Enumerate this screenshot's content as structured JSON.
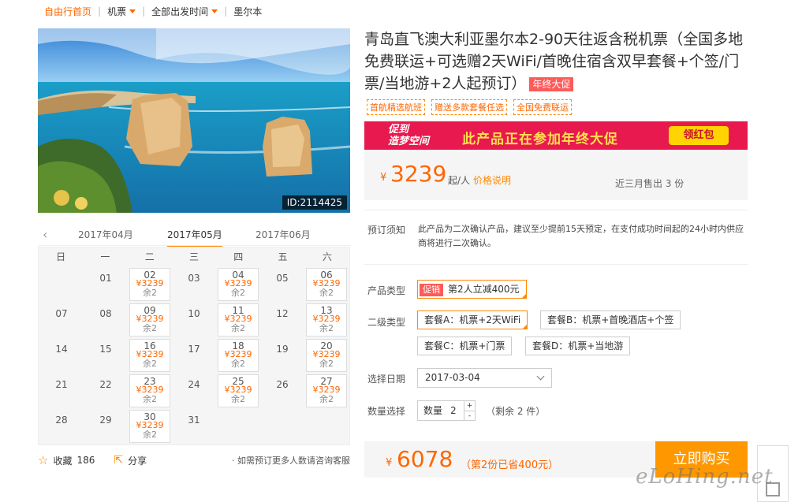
{
  "breadcrumb": {
    "home": "自由行首页",
    "item2": "机票",
    "item3": "全部出发时间",
    "item4": "墨尔本"
  },
  "hero": {
    "id_label": "ID:2114425"
  },
  "calendar": {
    "months": [
      "2017年04月",
      "2017年05月",
      "2017年06月"
    ],
    "current_month_index": 1,
    "weekdays": [
      "日",
      "一",
      "二",
      "三",
      "四",
      "五",
      "六"
    ],
    "leading_blanks": 1,
    "days": [
      {
        "d": "01"
      },
      {
        "d": "02",
        "price": "¥3239",
        "remain": "余2"
      },
      {
        "d": "03"
      },
      {
        "d": "04",
        "price": "¥3239",
        "remain": "余2"
      },
      {
        "d": "05"
      },
      {
        "d": "06",
        "price": "¥3239",
        "remain": "余2"
      },
      {
        "d": "07"
      },
      {
        "d": "08"
      },
      {
        "d": "09",
        "price": "¥3239",
        "remain": "余2"
      },
      {
        "d": "10"
      },
      {
        "d": "11",
        "price": "¥3239",
        "remain": "余2"
      },
      {
        "d": "12"
      },
      {
        "d": "13",
        "price": "¥3239",
        "remain": "余2"
      },
      {
        "d": "14"
      },
      {
        "d": "15"
      },
      {
        "d": "16",
        "price": "¥3239",
        "remain": "余2"
      },
      {
        "d": "17"
      },
      {
        "d": "18",
        "price": "¥3239",
        "remain": "余2"
      },
      {
        "d": "19"
      },
      {
        "d": "20",
        "price": "¥3239",
        "remain": "余2"
      },
      {
        "d": "21"
      },
      {
        "d": "22"
      },
      {
        "d": "23",
        "price": "¥3239",
        "remain": "余2"
      },
      {
        "d": "24"
      },
      {
        "d": "25",
        "price": "¥3239",
        "remain": "余2"
      },
      {
        "d": "26"
      },
      {
        "d": "27",
        "price": "¥3239",
        "remain": "余2"
      },
      {
        "d": "28"
      },
      {
        "d": "29"
      },
      {
        "d": "30",
        "price": "¥3239",
        "remain": "余2"
      },
      {
        "d": "31"
      }
    ]
  },
  "footer": {
    "collect_label": "收藏",
    "collect_count": "186",
    "share_label": "分享",
    "note": "· 如需预订更多人数请咨询客服"
  },
  "product": {
    "title": "青岛直飞澳大利亚墨尔本2-90天往返含税机票（全国多地免费联运+可选赠2天WiFi/首晚住宿含双早套餐+个签/门票/当地游+2人起预订）",
    "promo_badge": "年终大促",
    "tags": [
      "首航精选航班",
      "赠送多款套餐任选",
      "全国免费联运"
    ]
  },
  "banner": {
    "logo_line1": "促到",
    "logo_line2": "造梦空间",
    "text": "此产品正在参加年终大促",
    "button": "领红包"
  },
  "price": {
    "currency": "¥",
    "amount": "3239",
    "unit": "起/人",
    "explain": "价格说明",
    "sold": "近三月售出 3 份"
  },
  "notice": {
    "label": "预订须知",
    "text": "此产品为二次确认产品，建议至少提前15天预定，在支付成功时间起的24小时内供应商将进行二次确认。"
  },
  "options": {
    "type_label": "产品类型",
    "type_tag": "促销",
    "type_value": "第2人立减400元",
    "sub_label": "二级类型",
    "packages": [
      "套餐A：机票+2天WiFi",
      "套餐B：机票+首晚酒店+个签",
      "套餐C：机票+门票",
      "套餐D：机票+当地游"
    ],
    "date_label": "选择日期",
    "date_value": "2017-03-04",
    "qty_label": "数量选择",
    "qty_prefix": "数量",
    "qty_value": "2",
    "qty_plus": "+",
    "qty_minus": "-",
    "remain": "（剩余 2 件）"
  },
  "total": {
    "currency": "¥",
    "amount": "6078",
    "saved": "（第2份已省400元）",
    "buy_button": "立即购买"
  },
  "colors": {
    "accent": "#ff6600",
    "button": "#ff9800",
    "promo": "#e8194e"
  },
  "watermark": "eLoHing.net"
}
